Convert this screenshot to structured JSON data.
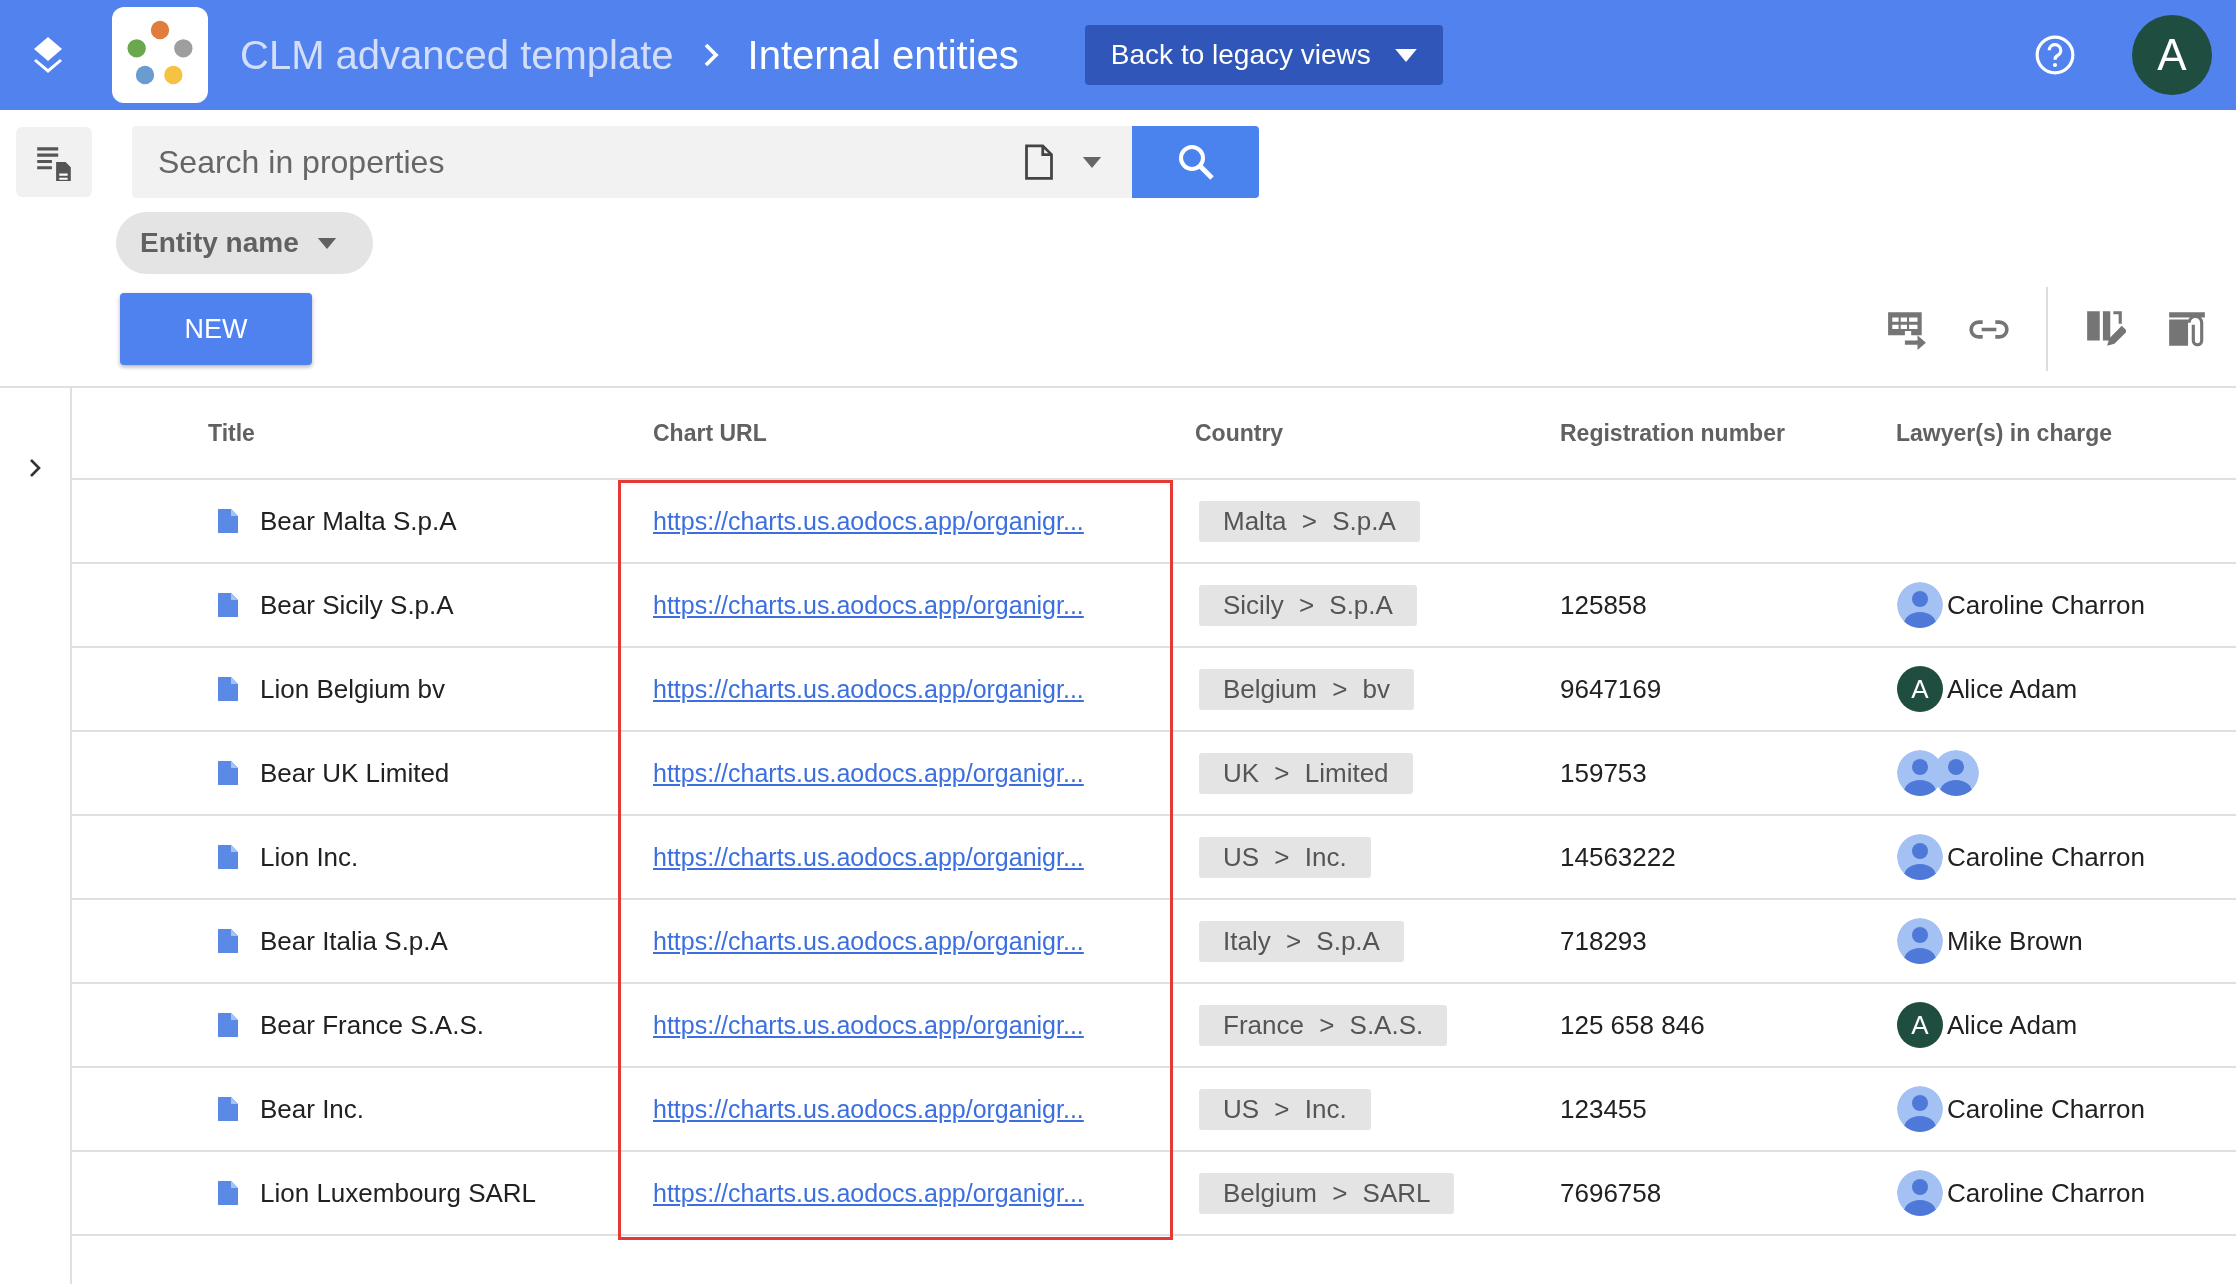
{
  "header": {
    "breadcrumb": [
      "CLM advanced template",
      "Internal entities"
    ],
    "legacy_button": "Back to legacy views",
    "user_initial": "A"
  },
  "search": {
    "placeholder": "Search in properties"
  },
  "filters": [
    {
      "label": "Entity name"
    }
  ],
  "new_button": "NEW",
  "table": {
    "columns": [
      "Title",
      "Chart URL",
      "Country",
      "Registration number",
      "Lawyer(s) in charge"
    ],
    "rows": [
      {
        "title": "Bear Malta S.p.A",
        "url": "https://charts.us.aodocs.app/organigr...",
        "country": "Malta > S.p.A"
      },
      {
        "title": "Bear Sicily S.p.A",
        "url": "https://charts.us.aodocs.app/organigr...",
        "country": "Sicily > S.p.A",
        "registration": "125858",
        "lawyer": {
          "avatars": [
            {
              "kind": "person"
            }
          ],
          "name": "Caroline Charron"
        }
      },
      {
        "title": "Lion Belgium bv",
        "url": "https://charts.us.aodocs.app/organigr...",
        "country": "Belgium > bv",
        "registration": "9647169",
        "lawyer": {
          "avatars": [
            {
              "kind": "initial",
              "initial": "A"
            }
          ],
          "name": "Alice Adam"
        }
      },
      {
        "title": "Bear UK Limited",
        "url": "https://charts.us.aodocs.app/organigr...",
        "country": "UK > Limited",
        "registration": "159753",
        "lawyer": {
          "avatars": [
            {
              "kind": "person"
            },
            {
              "kind": "person"
            }
          ]
        }
      },
      {
        "title": "Lion Inc.",
        "url": "https://charts.us.aodocs.app/organigr...",
        "country": "US > Inc.",
        "registration": "14563222",
        "lawyer": {
          "avatars": [
            {
              "kind": "person"
            }
          ],
          "name": "Caroline Charron"
        }
      },
      {
        "title": "Bear Italia S.p.A",
        "url": "https://charts.us.aodocs.app/organigr...",
        "country": "Italy > S.p.A",
        "registration": "718293",
        "lawyer": {
          "avatars": [
            {
              "kind": "person"
            }
          ],
          "name": "Mike Brown"
        }
      },
      {
        "title": "Bear France S.A.S.",
        "url": "https://charts.us.aodocs.app/organigr...",
        "country": "France > S.A.S.",
        "registration": "125 658 846",
        "lawyer": {
          "avatars": [
            {
              "kind": "initial",
              "initial": "A"
            }
          ],
          "name": "Alice Adam"
        }
      },
      {
        "title": "Bear Inc.",
        "url": "https://charts.us.aodocs.app/organigr...",
        "country": "US > Inc.",
        "registration": "123455",
        "lawyer": {
          "avatars": [
            {
              "kind": "person"
            }
          ],
          "name": "Caroline Charron"
        }
      },
      {
        "title": "Lion Luxembourg SARL",
        "url": "https://charts.us.aodocs.app/organigr...",
        "country": "Belgium > SARL",
        "registration": "7696758",
        "lawyer": {
          "avatars": [
            {
              "kind": "person"
            }
          ],
          "name": "Caroline Charron"
        }
      }
    ]
  }
}
